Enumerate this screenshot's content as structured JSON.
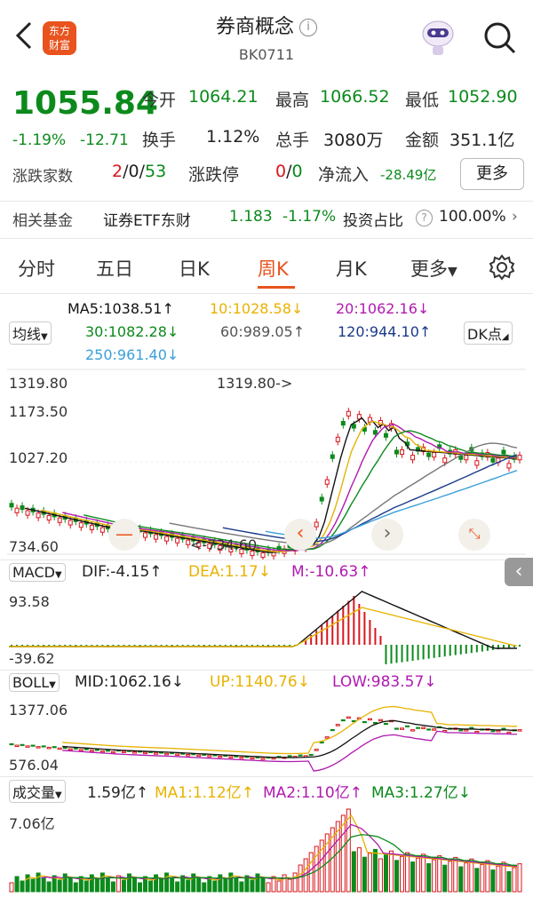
{
  "header": {
    "title": "券商概念",
    "code": "BK0711",
    "logo_text": "东方财富"
  },
  "quote": {
    "price": "1055.84",
    "change_pct": "-1.19%",
    "change": "-12.71",
    "open_label": "今开",
    "open": "1064.21",
    "high_label": "最高",
    "high": "1066.52",
    "low_label": "最低",
    "low": "1052.90",
    "turnover_label": "换手",
    "turnover": "1.12%",
    "volume_label": "总手",
    "volume": "3080万",
    "amount_label": "金额",
    "amount": "351.1亿",
    "updown_label": "涨跌家数",
    "up": "2",
    "flat": "0",
    "down": "53",
    "limit_label": "涨跌停",
    "limit_up": "0",
    "limit_down": "0",
    "netflow_label": "净流入",
    "netflow": "-28.49亿",
    "more": "更多"
  },
  "fund": {
    "label": "相关基金",
    "name": "证券ETF东财",
    "price": "1.183",
    "change": "-1.17%",
    "ratio_label": "投资占比",
    "ratio": "100.00%"
  },
  "tabs": [
    "分时",
    "五日",
    "日K",
    "周K",
    "月K",
    "更多"
  ],
  "active_tab": "周K",
  "ma": {
    "ma5": "MA5:1038.51↑",
    "ma10": "10:1028.58↓",
    "ma20": "20:1062.16↓",
    "ma30": "30:1082.28↓",
    "ma60": "60:989.05↑",
    "ma120": "120:944.10↑",
    "ma250": "250:961.40↓",
    "selector": "均线",
    "dk": "DK点"
  },
  "kline": {
    "y_labels": [
      "1319.80",
      "1173.50",
      "1027.20",
      "734.60"
    ],
    "high_annot": "1319.80->",
    "low_annot": "<-734.60"
  },
  "macd": {
    "name": "MACD",
    "dif": "DIF:-4.15↑",
    "dea": "DEA:1.17↓",
    "m": "M:-10.63↑",
    "y_top": "93.58",
    "y_bottom": "-39.62"
  },
  "boll": {
    "name": "BOLL",
    "mid": "MID:1062.16↓",
    "up": "UP:1140.76↓",
    "low": "LOW:983.57↓",
    "y_top": "1377.06",
    "y_bottom": "576.04"
  },
  "vol": {
    "name": "成交量",
    "v": "1.59亿↑",
    "ma1": "MA1:1.12亿↑",
    "ma2": "MA2:1.10亿↑",
    "ma3": "MA3:1.27亿↓",
    "y_top": "7.06亿"
  },
  "colors": {
    "up": "#d9161c",
    "down": "#0c8a1c",
    "ma5": "#111111",
    "ma10": "#e8b200",
    "ma20": "#b01ab0",
    "ma30": "#0c8a1c",
    "ma60": "#777777",
    "ma120": "#1a3a8a",
    "ma250": "#3aa0d8"
  }
}
